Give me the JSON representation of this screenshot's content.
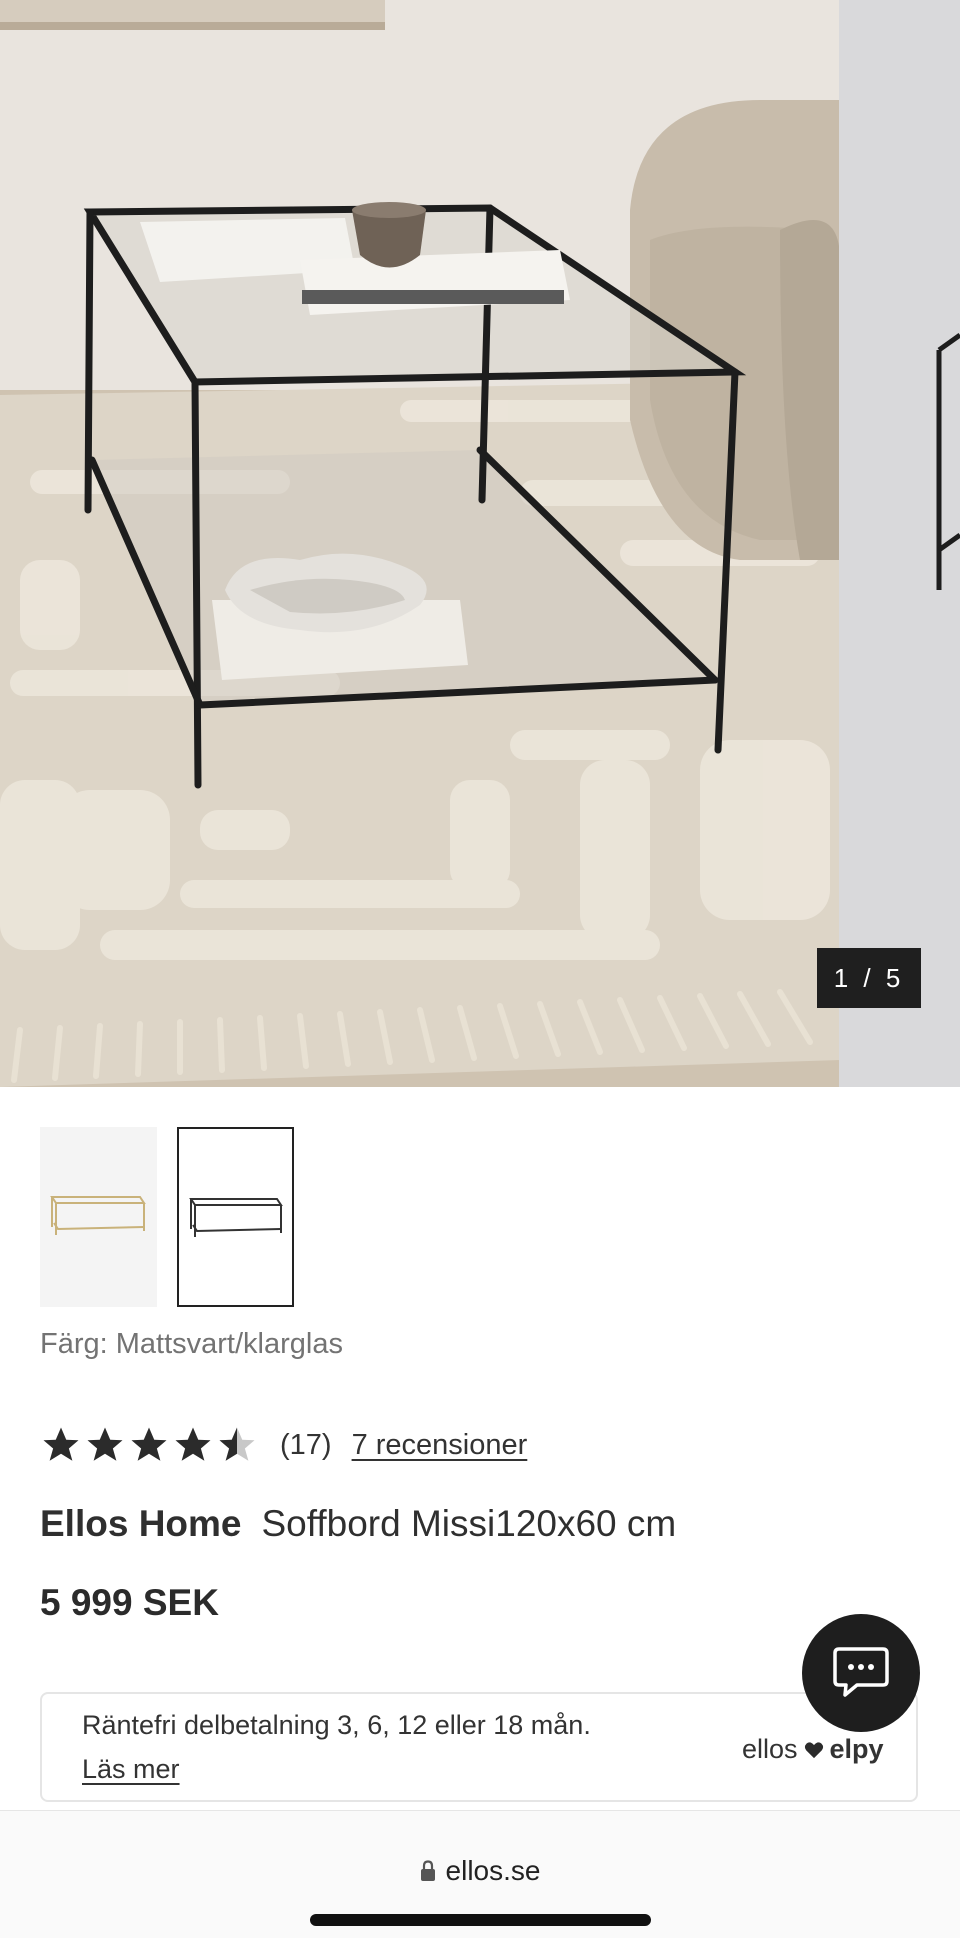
{
  "gallery": {
    "counter_current": "1",
    "counter_separator": "/",
    "counter_total": "5",
    "counter_text": "1 / 5"
  },
  "thumbnails": [
    {
      "label": "brass-gold variant",
      "selected": false
    },
    {
      "label": "matte black variant",
      "selected": true
    }
  ],
  "product": {
    "color_label": "Färg: Mattsvart/klarglas",
    "rating_value": 4.5,
    "rating_count": "(17)",
    "reviews_link": "7 recensioner",
    "brand": "Ellos Home",
    "name": "Soffbord Missi120x60 cm",
    "price": "5 999 SEK"
  },
  "finance": {
    "text": "Räntefri delbetalning 3, 6, 12 eller 18 mån.",
    "link": "Läs mer",
    "logo_left": "ellos",
    "logo_right": "elpy"
  },
  "browser": {
    "url": "ellos.se"
  },
  "icons": {
    "chat": "chat-bubble-icon",
    "lock": "lock-icon",
    "heart": "heart-icon",
    "star": "star-icon"
  },
  "colors": {
    "dark": "#1e1e1e",
    "muted_text": "#737373",
    "rug": "#dcd4c6",
    "wall": "#e8e3dc"
  }
}
